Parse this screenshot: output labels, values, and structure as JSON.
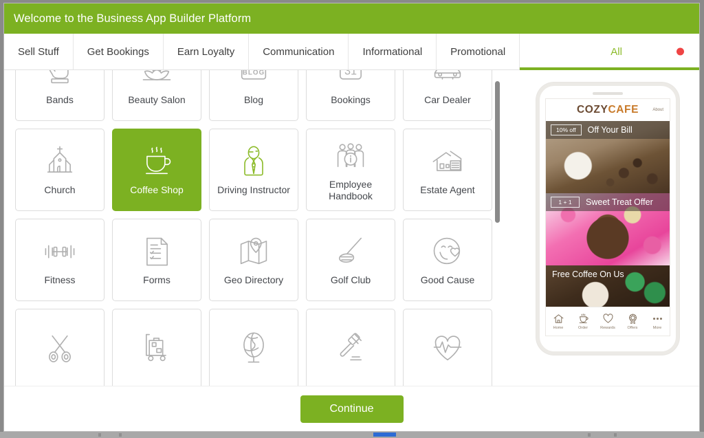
{
  "window": {
    "title": "Welcome to the Business App Builder Platform"
  },
  "tabs": [
    {
      "label": "Sell Stuff",
      "active": false
    },
    {
      "label": "Get Bookings",
      "active": false
    },
    {
      "label": "Earn Loyalty",
      "active": false
    },
    {
      "label": "Communication",
      "active": false
    },
    {
      "label": "Informational",
      "active": false
    },
    {
      "label": "Promotional",
      "active": false
    },
    {
      "label": "All",
      "active": true,
      "badge_color": "#ef4444"
    }
  ],
  "grid": {
    "tiles": [
      {
        "label": "Bands",
        "icon": "hand-rock-icon",
        "state": "normal"
      },
      {
        "label": "Beauty Salon",
        "icon": "lotus-flower-icon",
        "state": "normal"
      },
      {
        "label": "Blog",
        "icon": "blog-icon",
        "state": "normal"
      },
      {
        "label": "Bookings",
        "icon": "calendar-31-icon",
        "state": "normal"
      },
      {
        "label": "Car Dealer",
        "icon": "car-icon",
        "state": "normal"
      },
      {
        "label": "Church",
        "icon": "church-icon",
        "state": "normal"
      },
      {
        "label": "Coffee Shop",
        "icon": "coffee-cup-icon",
        "state": "selected"
      },
      {
        "label": "Driving Instructor",
        "icon": "instructor-icon",
        "state": "hovered"
      },
      {
        "label": "Employee Handbook",
        "icon": "people-info-icon",
        "state": "normal"
      },
      {
        "label": "Estate Agent",
        "icon": "house-icon",
        "state": "normal"
      },
      {
        "label": "Fitness",
        "icon": "dumbbell-icon",
        "state": "normal"
      },
      {
        "label": "Forms",
        "icon": "form-checklist-icon",
        "state": "normal"
      },
      {
        "label": "Geo Directory",
        "icon": "map-pin-icon",
        "state": "normal"
      },
      {
        "label": "Golf Club",
        "icon": "golf-club-icon",
        "state": "normal"
      },
      {
        "label": "Good Cause",
        "icon": "smiley-heart-icon",
        "state": "normal"
      },
      {
        "label": "",
        "icon": "scissors-icon",
        "state": "normal"
      },
      {
        "label": "",
        "icon": "luggage-cart-icon",
        "state": "normal"
      },
      {
        "label": "",
        "icon": "globe-icon",
        "state": "normal"
      },
      {
        "label": "",
        "icon": "gavel-icon",
        "state": "normal"
      },
      {
        "label": "",
        "icon": "heartbeat-icon",
        "state": "normal"
      }
    ]
  },
  "preview": {
    "brand_part1": "COZY",
    "brand_part2": "CAFE",
    "about_label": "About",
    "cards": [
      {
        "chip": "10% off",
        "title": "Off Your Bill"
      },
      {
        "chip": "1 + 1",
        "title": "Sweet Treat Offer"
      },
      {
        "chip": "",
        "title": "Free Coffee On Us"
      }
    ],
    "nav": [
      {
        "label": "Home",
        "icon": "home-icon"
      },
      {
        "label": "Order",
        "icon": "cup-icon"
      },
      {
        "label": "Rewards",
        "icon": "heart-icon"
      },
      {
        "label": "Offers",
        "icon": "ribbon-badge-icon"
      },
      {
        "label": "More",
        "icon": "ellipsis-icon"
      }
    ]
  },
  "footer": {
    "continue_label": "Continue"
  },
  "colors": {
    "brand_green": "#7cb122",
    "badge_red": "#ef4444",
    "scroll_blue": "#2d6bd4"
  }
}
